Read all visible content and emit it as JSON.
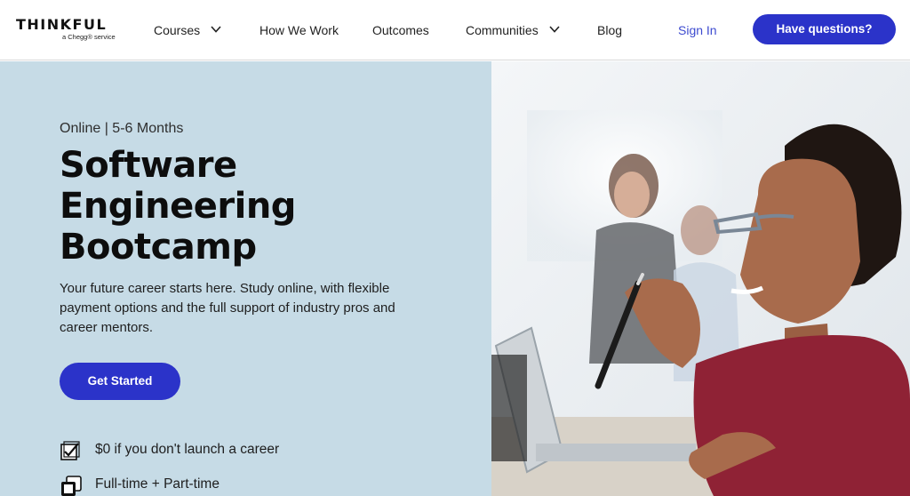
{
  "brand": {
    "name": "THINKFUL",
    "tagline": "a Chegg® service"
  },
  "nav": {
    "items": [
      {
        "label": "Courses",
        "has_dropdown": true
      },
      {
        "label": "How We Work",
        "has_dropdown": false
      },
      {
        "label": "Outcomes",
        "has_dropdown": false
      },
      {
        "label": "Communities",
        "has_dropdown": true
      },
      {
        "label": "Blog",
        "has_dropdown": false
      }
    ],
    "sign_in": "Sign In",
    "cta": "Have questions?"
  },
  "hero": {
    "eyebrow": "Online | 5-6 Months",
    "title_lines": [
      "Software",
      "Engineering",
      "Bootcamp"
    ],
    "description": "Your future career starts here. Study online, with flexible payment options and the full support of industry pros and career mentors.",
    "cta": "Get Started",
    "features": [
      {
        "icon": "checkbox-icon",
        "text": "$0 if you don't launch a career"
      },
      {
        "icon": "stacked-squares-icon",
        "text": "Full-time + Part-time"
      }
    ]
  },
  "colors": {
    "accent": "#2b33c9",
    "hero_background": "#c6dbe6",
    "link": "#3d4bd0"
  }
}
